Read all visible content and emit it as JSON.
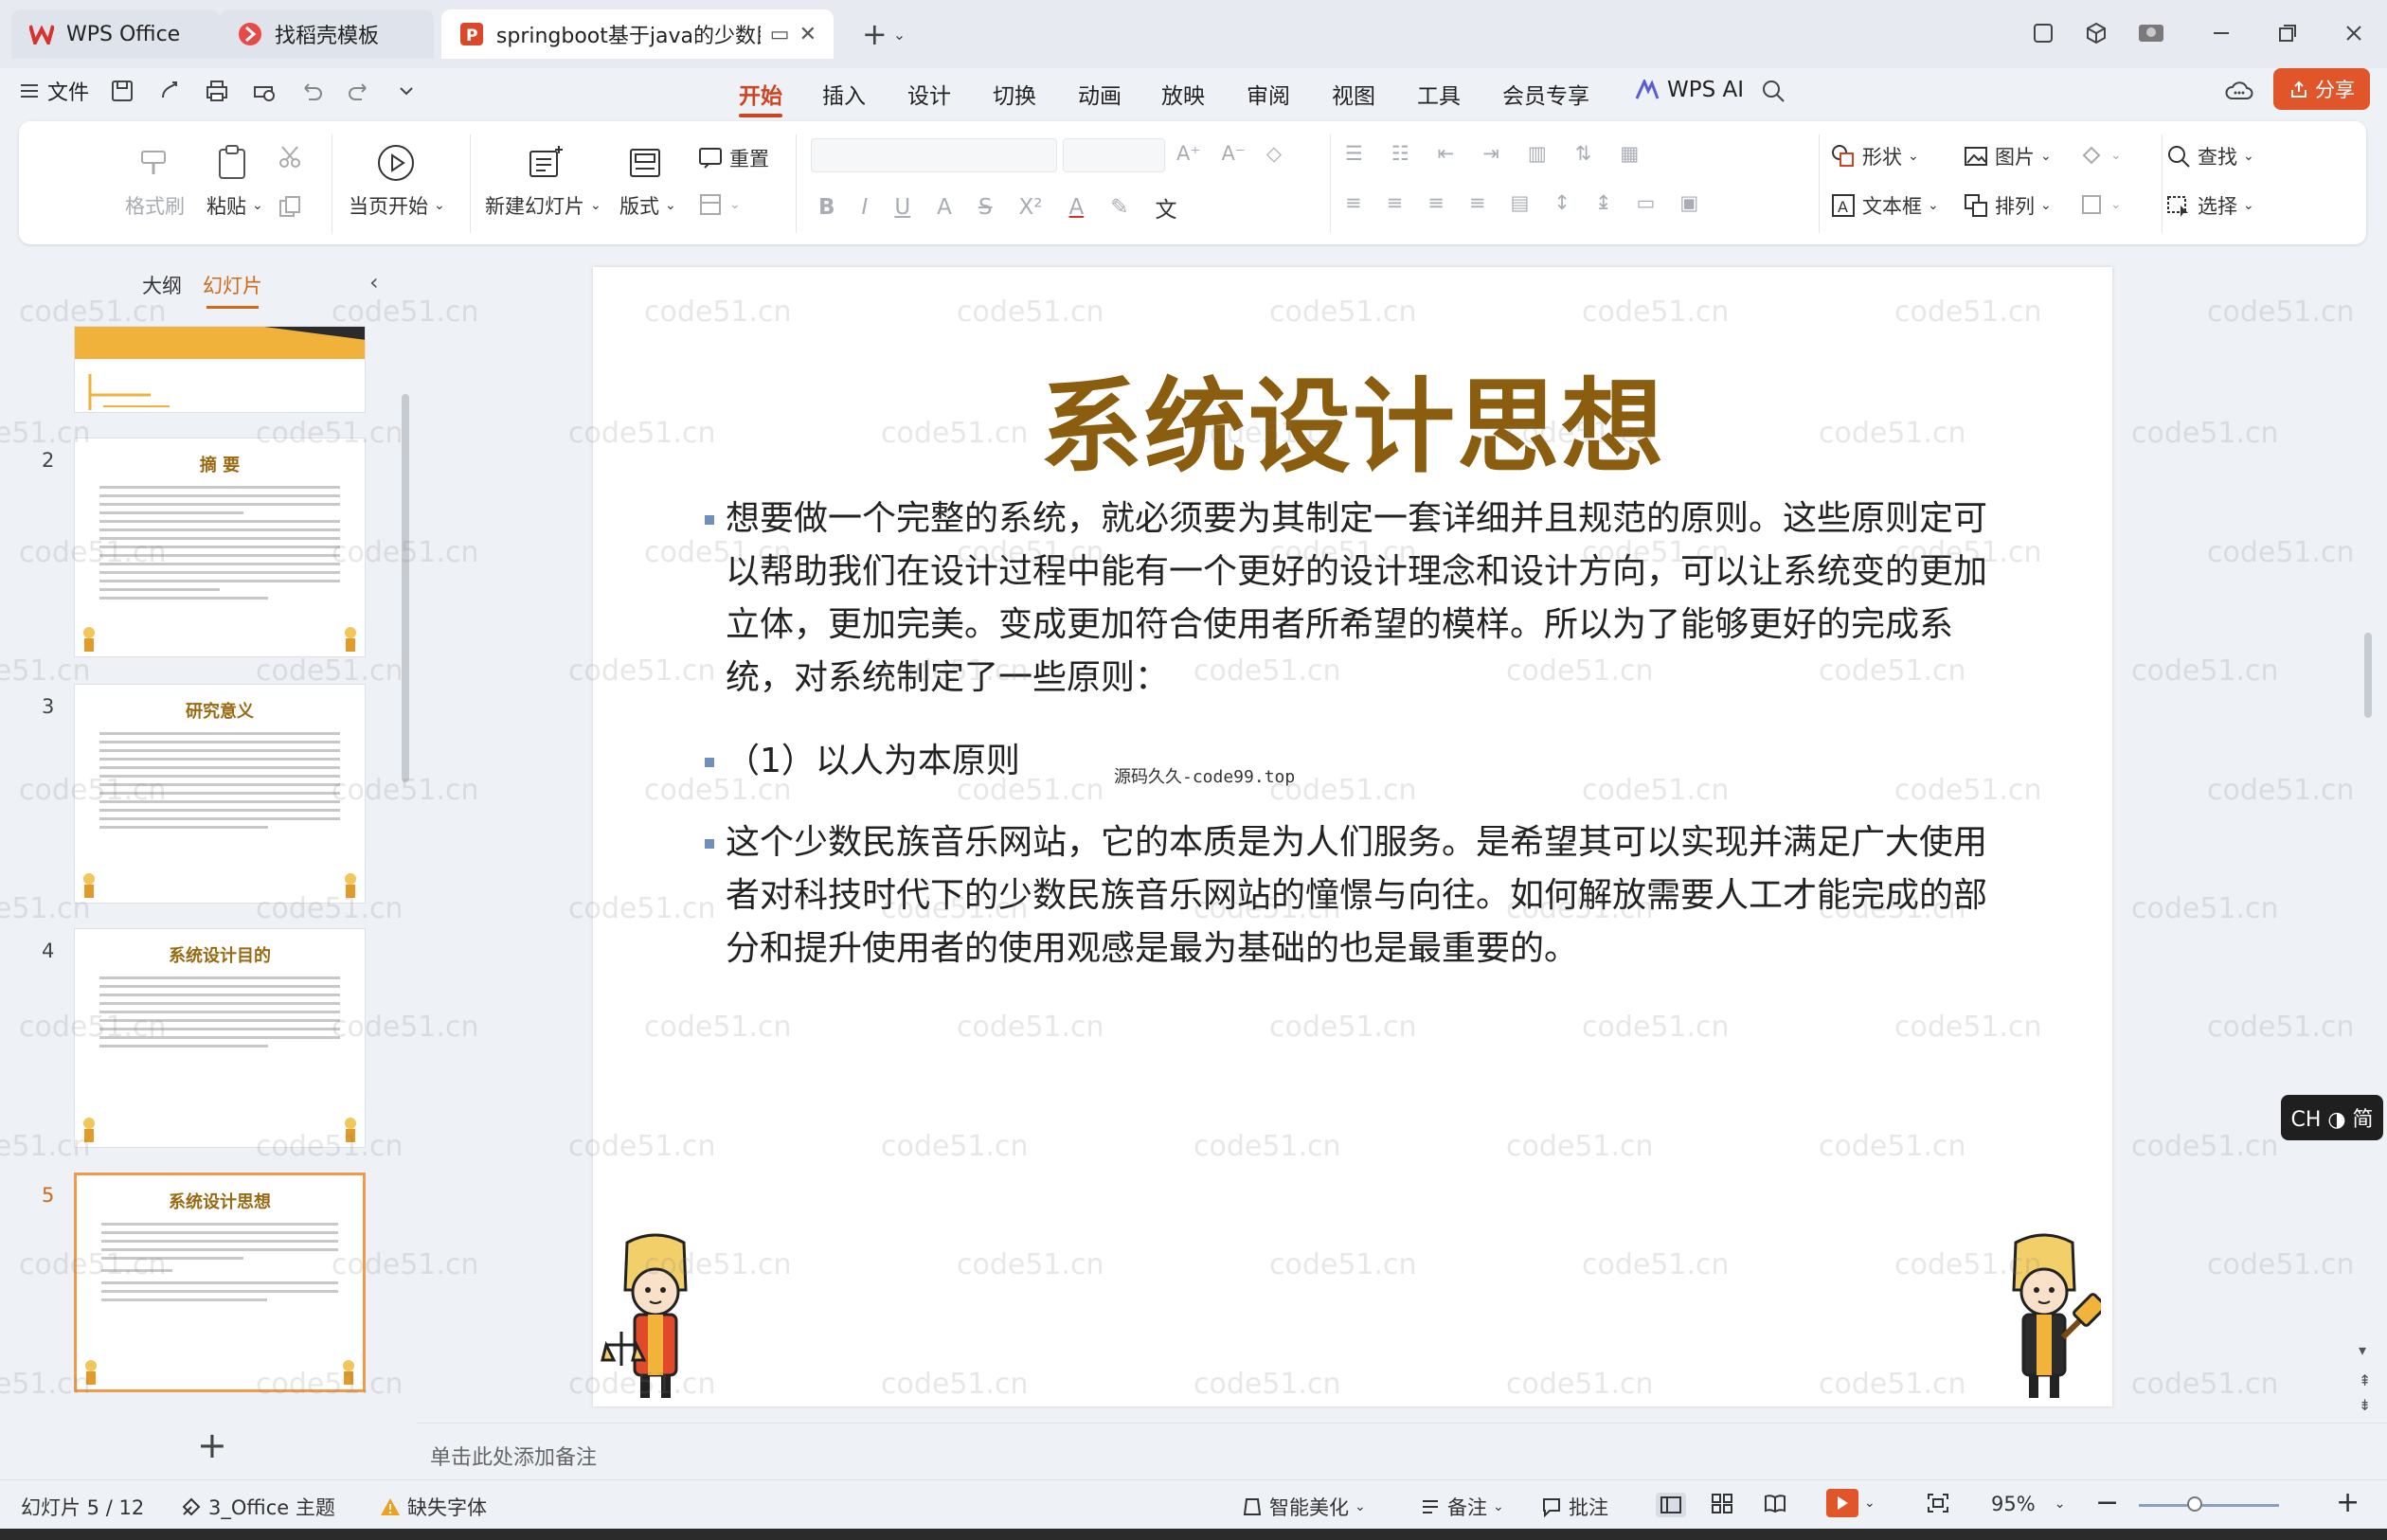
{
  "titlebar": {
    "tabs": [
      {
        "label": "WPS Office"
      },
      {
        "label": "找稻壳模板"
      },
      {
        "label": "springboot基于java的少数民"
      }
    ]
  },
  "menubar": {
    "file_label": "文件",
    "menus": [
      "开始",
      "插入",
      "设计",
      "切换",
      "动画",
      "放映",
      "审阅",
      "视图",
      "工具",
      "会员专享"
    ],
    "active_menu": "开始",
    "wps_ai_label": "WPS AI",
    "share_label": "分享"
  },
  "ribbon": {
    "format_brush": "格式刷",
    "paste": "粘贴",
    "play_from_current": "当页开始",
    "new_slide": "新建幻灯片",
    "layout": "版式",
    "reset": "重置",
    "shape": "形状",
    "picture": "图片",
    "textbox": "文本框",
    "arrange": "排列",
    "find": "查找",
    "select": "选择"
  },
  "leftpanel": {
    "tab_outline": "大纲",
    "tab_slides": "幻灯片",
    "thumbnails": [
      {
        "num": "2",
        "title": "摘  要"
      },
      {
        "num": "3",
        "title": "研究意义"
      },
      {
        "num": "4",
        "title": "系统设计目的"
      },
      {
        "num": "5",
        "title": "系统设计思想"
      }
    ]
  },
  "slide": {
    "title": "系统设计思想",
    "paragraph1": "想要做一个完整的系统，就必须要为其制定一套详细并且规范的原则。这些原则定可以帮助我们在设计过程中能有一个更好的设计理念和设计方向，可以让系统变的更加立体，更加完美。变成更加符合使用者所希望的模样。所以为了能够更好的完成系统，对系统制定了一些原则：",
    "paragraph2": "（1）以人为本原则",
    "paragraph3": "这个少数民族音乐网站，它的本质是为人们服务。是希望其可以实现并满足广大使用者对科技时代下的少数民族音乐网站的憧憬与向往。如何解放需要人工才能完成的部分和提升使用者的使用观感是最为基础的也是最重要的。",
    "source_note": "源码久久-code99.top"
  },
  "notes_placeholder": "单击此处添加备注",
  "ime_label": "CH ◑ 简",
  "statusbar": {
    "slide_counter": "幻灯片 5 / 12",
    "theme": "3_Office 主题",
    "missing_font": "缺失字体",
    "beautify": "智能美化",
    "notes": "备注",
    "comments": "批注",
    "zoom": "95%",
    "zoom_fraction": 0.4
  },
  "watermark": "code51.cn",
  "colors": {
    "accent": "#d0431f",
    "title_gold": "#8a5d0f",
    "selected_thumb": "#f09a4a"
  }
}
